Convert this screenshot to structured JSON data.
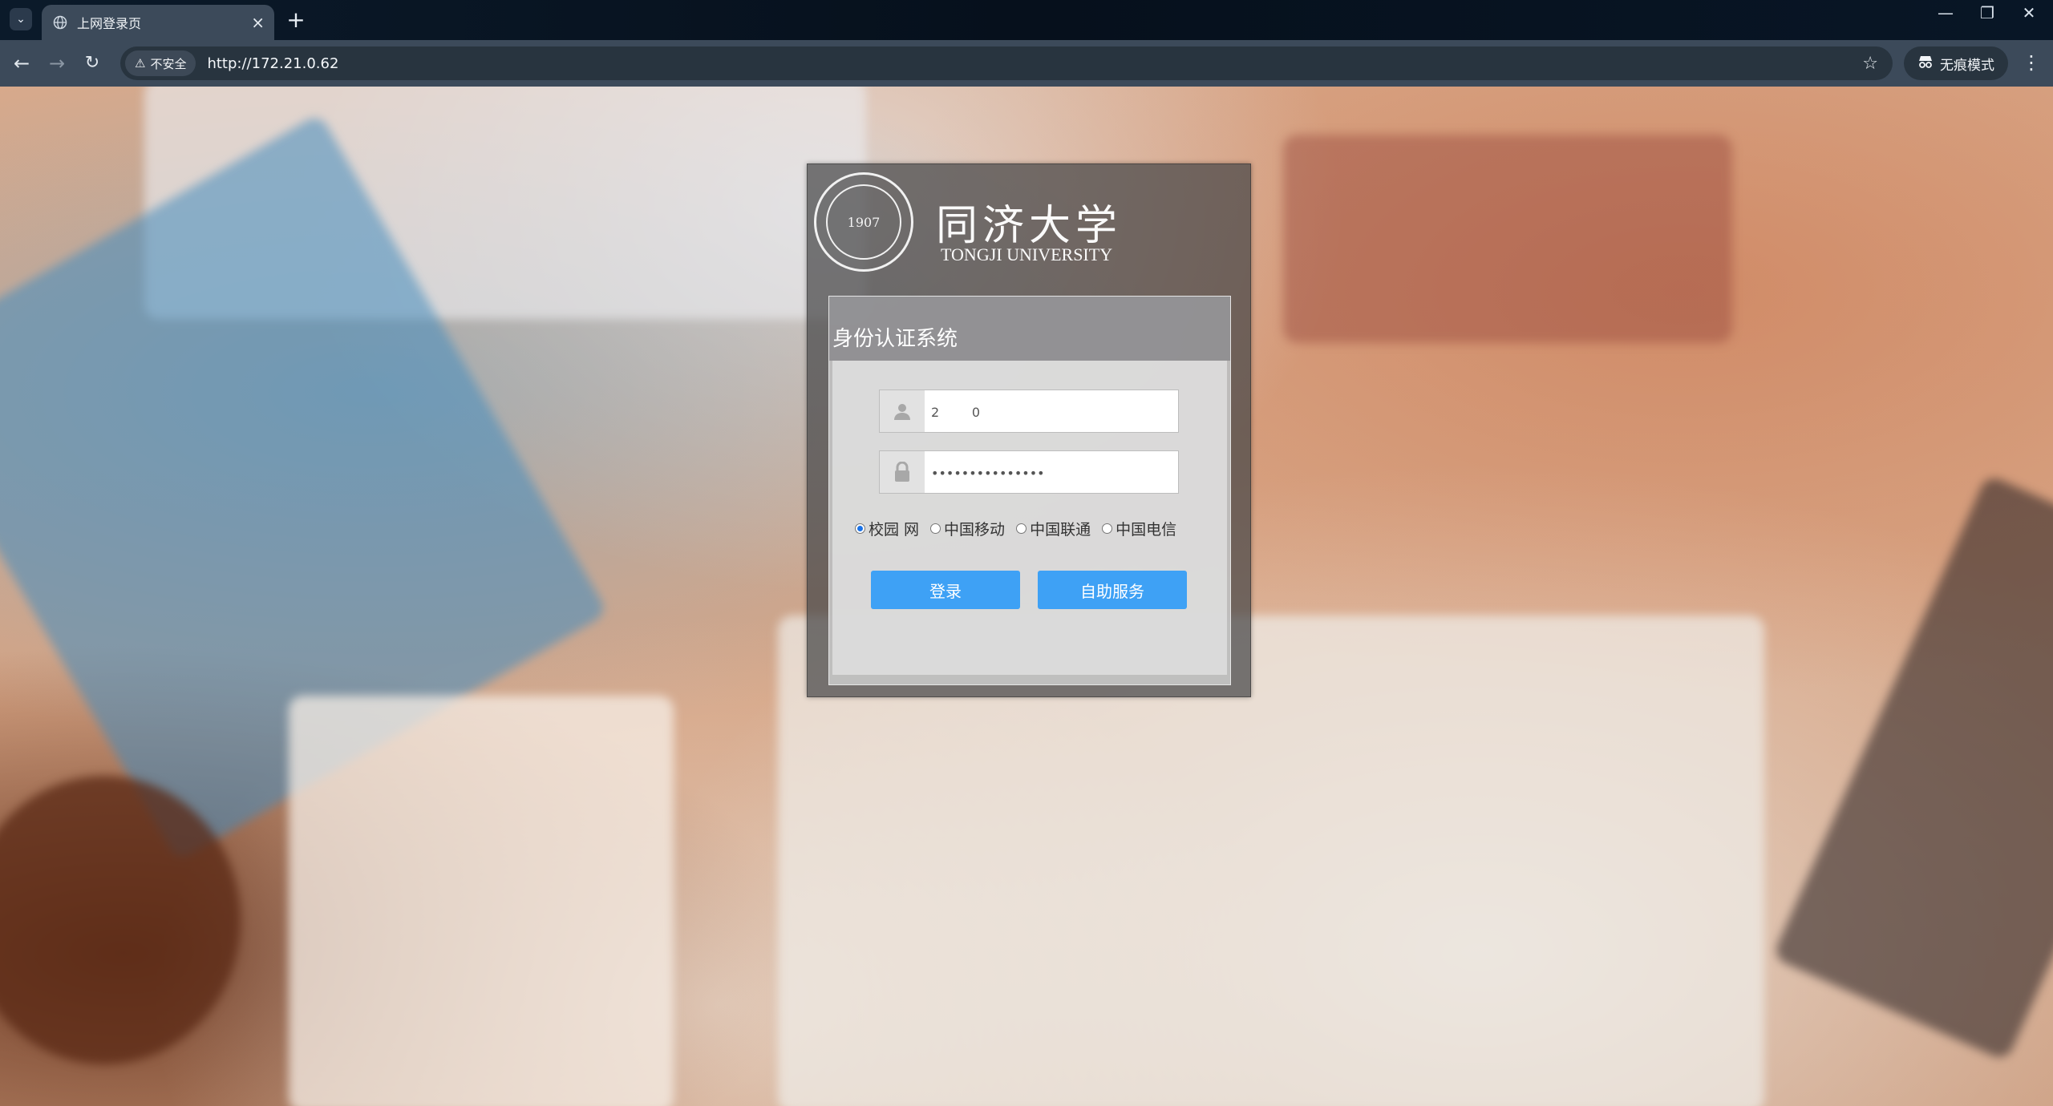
{
  "browser": {
    "tab_title": "上网登录页",
    "tab_close": "×",
    "new_tab": "+",
    "security_label": "不安全",
    "url": "http://172.21.0.62",
    "incognito_label": "无痕模式",
    "window_controls": [
      "—",
      "❐",
      "✕"
    ]
  },
  "login": {
    "university_name_cn": "同济大学",
    "university_name_en": "TONGJI UNIVERSITY",
    "seal_year": "1907",
    "system_title": "身份认证系统",
    "username_value": "2        0",
    "password_value": "•••••••••••••••",
    "network_options": [
      {
        "label": "校园 网",
        "selected": true
      },
      {
        "label": "中国移动",
        "selected": false
      },
      {
        "label": "中国联通",
        "selected": false
      },
      {
        "label": "中国电信",
        "selected": false
      }
    ],
    "login_button": "登录",
    "self_service_button": "自助服务"
  },
  "colors": {
    "button_blue": "#3ea1f5",
    "chrome_bg": "#3c4a5a"
  }
}
